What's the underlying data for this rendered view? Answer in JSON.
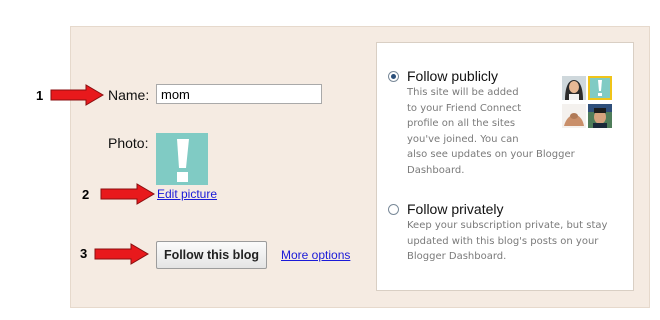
{
  "steps": {
    "one": "1",
    "two": "2",
    "three": "3"
  },
  "form": {
    "name_label": "Name:",
    "name_value": "mom",
    "photo_label": "Photo:",
    "edit_picture_link": "Edit picture",
    "follow_button": "Follow this blog",
    "more_options_link": "More options"
  },
  "options": {
    "public": {
      "title": "Follow publicly",
      "checked": true,
      "description_lines": [
        "This site will be added",
        "to your Friend Connect",
        "profile on all the sites",
        "you've joined. You can",
        "also see updates on your Blogger",
        "Dashboard."
      ]
    },
    "private": {
      "title": "Follow privately",
      "checked": false,
      "description_lines": [
        "Keep your subscription private, but stay",
        "updated with this blog's posts on your",
        "Blogger Dashboard."
      ]
    }
  },
  "colors": {
    "panel_background": "#f5ebe2",
    "arrow_red": "#e8191c",
    "photo_teal": "#80cbc4",
    "link_blue": "#1a1ad8"
  },
  "icons": {
    "arrow": "red-right-arrow",
    "photo": "exclamation-mark-placeholder",
    "friend_avatars": [
      "woman-avatar",
      "exclamation-avatar",
      "hand-avatar",
      "man-avatar"
    ]
  }
}
